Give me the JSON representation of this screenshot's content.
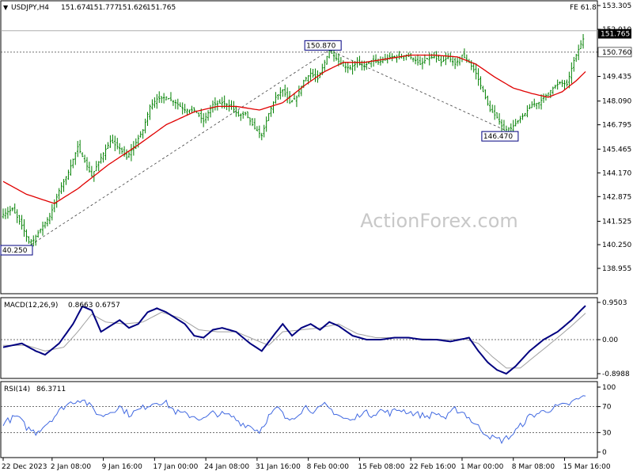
{
  "chart_data": {
    "type": "line",
    "instrument": {
      "header": "USDJPY,H4",
      "ohlc": [
        "151.674",
        "151.777",
        "151.626",
        "151.765"
      ]
    },
    "watermark": "ActionForex.com",
    "fib_label": "FE 61.8",
    "price_axis": {
      "range": [
        138.5,
        153.5
      ],
      "ticks": [
        "153.305",
        "152.010",
        "150.760",
        "149.435",
        "148.090",
        "146.795",
        "145.465",
        "144.170",
        "142.875",
        "141.525",
        "140.250",
        "138.955"
      ],
      "tick_values": [
        153.305,
        152.01,
        150.76,
        149.435,
        148.09,
        146.795,
        145.465,
        144.17,
        142.875,
        141.525,
        140.25,
        138.955
      ]
    },
    "current_price": {
      "label": "151.765",
      "value": 151.765,
      "color": "#000000"
    },
    "horizontal_level": {
      "label": "150.760",
      "value": 150.76
    },
    "fe_level_value": 151.93,
    "annotations": [
      {
        "label": "40.250",
        "bar": 12,
        "value": 140.25
      },
      {
        "label": "150.870",
        "bar": 140,
        "value": 150.87
      },
      {
        "label": "146.470",
        "bar": 216,
        "value": 146.47
      }
    ],
    "trendlines": [
      {
        "from": {
          "bar": 12,
          "value": 140.25
        },
        "to": {
          "bar": 140,
          "value": 150.87
        }
      },
      {
        "from": {
          "bar": 140,
          "value": 150.87
        },
        "to": {
          "bar": 216,
          "value": 146.47
        }
      }
    ],
    "x_labels": [
      "22 Dec 2023",
      "2 Jan 08:00",
      "9 Jan 16:00",
      "17 Jan 00:00",
      "24 Jan 08:00",
      "31 Jan 16:00",
      "8 Feb 00:00",
      "15 Feb 08:00",
      "22 Feb 16:00",
      "1 Mar 00:00",
      "8 Mar 08:00",
      "15 Mar 16:00"
    ],
    "x_label_bars": [
      0,
      21,
      43,
      65,
      87,
      109,
      131,
      153,
      175,
      197,
      219,
      241
    ],
    "bar_count": 250,
    "price_anchors": [
      [
        0,
        141.9
      ],
      [
        4,
        142.2
      ],
      [
        8,
        141.3
      ],
      [
        11,
        140.4
      ],
      [
        13,
        140.5
      ],
      [
        16,
        141.1
      ],
      [
        20,
        141.8
      ],
      [
        24,
        143.2
      ],
      [
        28,
        144.2
      ],
      [
        32,
        145.6
      ],
      [
        35,
        144.8
      ],
      [
        38,
        144.0
      ],
      [
        42,
        145.0
      ],
      [
        46,
        145.9
      ],
      [
        50,
        145.5
      ],
      [
        53,
        145.0
      ],
      [
        56,
        145.6
      ],
      [
        60,
        146.5
      ],
      [
        63,
        147.8
      ],
      [
        66,
        148.2
      ],
      [
        70,
        148.3
      ],
      [
        74,
        148.0
      ],
      [
        78,
        147.6
      ],
      [
        82,
        147.6
      ],
      [
        86,
        147.0
      ],
      [
        90,
        147.9
      ],
      [
        94,
        148.0
      ],
      [
        98,
        147.8
      ],
      [
        101,
        147.3
      ],
      [
        104,
        147.4
      ],
      [
        108,
        146.6
      ],
      [
        111,
        146.2
      ],
      [
        114,
        147.4
      ],
      [
        117,
        148.3
      ],
      [
        120,
        148.7
      ],
      [
        123,
        148.0
      ],
      [
        126,
        148.3
      ],
      [
        129,
        149.2
      ],
      [
        132,
        149.6
      ],
      [
        135,
        149.3
      ],
      [
        138,
        150.2
      ],
      [
        140,
        150.85
      ],
      [
        143,
        150.4
      ],
      [
        146,
        150.0
      ],
      [
        149,
        149.9
      ],
      [
        152,
        150.2
      ],
      [
        155,
        150.0
      ],
      [
        158,
        150.3
      ],
      [
        161,
        150.2
      ],
      [
        164,
        150.4
      ],
      [
        167,
        150.5
      ],
      [
        170,
        150.5
      ],
      [
        173,
        150.6
      ],
      [
        176,
        150.4
      ],
      [
        179,
        150.1
      ],
      [
        182,
        150.4
      ],
      [
        185,
        150.5
      ],
      [
        188,
        150.2
      ],
      [
        191,
        150.5
      ],
      [
        194,
        150.1
      ],
      [
        197,
        150.6
      ],
      [
        200,
        150.2
      ],
      [
        203,
        149.6
      ],
      [
        206,
        148.6
      ],
      [
        209,
        147.6
      ],
      [
        212,
        147.2
      ],
      [
        215,
        146.5
      ],
      [
        218,
        146.6
      ],
      [
        221,
        147.0
      ],
      [
        224,
        147.4
      ],
      [
        227,
        147.9
      ],
      [
        230,
        148.0
      ],
      [
        233,
        148.4
      ],
      [
        236,
        148.8
      ],
      [
        239,
        149.1
      ],
      [
        242,
        149.0
      ],
      [
        245,
        150.3
      ],
      [
        248,
        151.2
      ],
      [
        250,
        151.765
      ]
    ],
    "ma_anchors": [
      [
        0,
        143.7
      ],
      [
        10,
        143.0
      ],
      [
        22,
        142.5
      ],
      [
        32,
        143.3
      ],
      [
        45,
        144.6
      ],
      [
        58,
        145.7
      ],
      [
        70,
        146.8
      ],
      [
        82,
        147.5
      ],
      [
        92,
        147.8
      ],
      [
        100,
        147.8
      ],
      [
        110,
        147.6
      ],
      [
        120,
        148.0
      ],
      [
        130,
        149.0
      ],
      [
        138,
        149.7
      ],
      [
        146,
        150.2
      ],
      [
        155,
        150.2
      ],
      [
        165,
        150.4
      ],
      [
        175,
        150.6
      ],
      [
        185,
        150.6
      ],
      [
        195,
        150.5
      ],
      [
        203,
        150.1
      ],
      [
        211,
        149.4
      ],
      [
        219,
        148.8
      ],
      [
        227,
        148.5
      ],
      [
        234,
        148.3
      ],
      [
        240,
        148.6
      ],
      [
        246,
        149.2
      ],
      [
        250,
        149.7
      ]
    ],
    "macd": {
      "label": "MACD(12,26,9)",
      "values_text": "0.8663 0.6757",
      "ticks": [
        "0.9503",
        "0.00",
        "-0.8988"
      ],
      "tick_values": [
        0.9503,
        0.0,
        -0.8988
      ],
      "range": [
        -1.0,
        1.1
      ],
      "main_anchors": [
        [
          0,
          -0.2
        ],
        [
          8,
          -0.1
        ],
        [
          14,
          -0.3
        ],
        [
          18,
          -0.4
        ],
        [
          24,
          -0.1
        ],
        [
          30,
          0.4
        ],
        [
          34,
          0.85
        ],
        [
          38,
          0.75
        ],
        [
          42,
          0.2
        ],
        [
          46,
          0.35
        ],
        [
          50,
          0.5
        ],
        [
          54,
          0.3
        ],
        [
          58,
          0.4
        ],
        [
          62,
          0.7
        ],
        [
          66,
          0.8
        ],
        [
          70,
          0.7
        ],
        [
          74,
          0.55
        ],
        [
          78,
          0.4
        ],
        [
          82,
          0.1
        ],
        [
          86,
          0.05
        ],
        [
          90,
          0.25
        ],
        [
          94,
          0.3
        ],
        [
          100,
          0.2
        ],
        [
          106,
          -0.1
        ],
        [
          111,
          -0.3
        ],
        [
          116,
          0.1
        ],
        [
          120,
          0.4
        ],
        [
          124,
          0.1
        ],
        [
          128,
          0.3
        ],
        [
          132,
          0.4
        ],
        [
          136,
          0.25
        ],
        [
          140,
          0.45
        ],
        [
          144,
          0.35
        ],
        [
          150,
          0.1
        ],
        [
          156,
          0.0
        ],
        [
          162,
          0.0
        ],
        [
          168,
          0.05
        ],
        [
          174,
          0.05
        ],
        [
          180,
          0.0
        ],
        [
          186,
          0.0
        ],
        [
          192,
          -0.05
        ],
        [
          196,
          0.0
        ],
        [
          200,
          0.05
        ],
        [
          204,
          -0.3
        ],
        [
          208,
          -0.6
        ],
        [
          212,
          -0.8
        ],
        [
          216,
          -0.9
        ],
        [
          220,
          -0.7
        ],
        [
          226,
          -0.3
        ],
        [
          232,
          0.0
        ],
        [
          238,
          0.2
        ],
        [
          244,
          0.5
        ],
        [
          248,
          0.75
        ],
        [
          250,
          0.8663
        ]
      ],
      "signal_anchors": [
        [
          0,
          -0.15
        ],
        [
          10,
          -0.15
        ],
        [
          18,
          -0.3
        ],
        [
          26,
          -0.2
        ],
        [
          32,
          0.2
        ],
        [
          38,
          0.65
        ],
        [
          44,
          0.45
        ],
        [
          52,
          0.4
        ],
        [
          60,
          0.45
        ],
        [
          68,
          0.7
        ],
        [
          76,
          0.55
        ],
        [
          84,
          0.25
        ],
        [
          92,
          0.2
        ],
        [
          100,
          0.2
        ],
        [
          108,
          0.0
        ],
        [
          114,
          -0.15
        ],
        [
          120,
          0.2
        ],
        [
          128,
          0.25
        ],
        [
          136,
          0.3
        ],
        [
          144,
          0.4
        ],
        [
          152,
          0.15
        ],
        [
          160,
          0.05
        ],
        [
          170,
          0.05
        ],
        [
          180,
          0.02
        ],
        [
          190,
          0.0
        ],
        [
          198,
          0.02
        ],
        [
          204,
          -0.1
        ],
        [
          210,
          -0.45
        ],
        [
          216,
          -0.75
        ],
        [
          222,
          -0.75
        ],
        [
          228,
          -0.45
        ],
        [
          236,
          -0.05
        ],
        [
          244,
          0.35
        ],
        [
          250,
          0.6757
        ]
      ]
    },
    "rsi": {
      "label": "RSI(14)",
      "value_text": "86.3711",
      "ticks": [
        "100",
        "70",
        "30",
        "0"
      ],
      "tick_values": [
        100,
        70,
        30,
        0
      ],
      "range": [
        0,
        100
      ],
      "levels": [
        70,
        30
      ],
      "anchors": [
        [
          0,
          45
        ],
        [
          6,
          55
        ],
        [
          10,
          38
        ],
        [
          14,
          30
        ],
        [
          18,
          42
        ],
        [
          22,
          55
        ],
        [
          26,
          70
        ],
        [
          30,
          78
        ],
        [
          34,
          82
        ],
        [
          38,
          68
        ],
        [
          42,
          55
        ],
        [
          46,
          62
        ],
        [
          50,
          70
        ],
        [
          54,
          58
        ],
        [
          58,
          64
        ],
        [
          62,
          72
        ],
        [
          66,
          78
        ],
        [
          70,
          75
        ],
        [
          74,
          62
        ],
        [
          78,
          58
        ],
        [
          82,
          55
        ],
        [
          86,
          50
        ],
        [
          90,
          60
        ],
        [
          94,
          58
        ],
        [
          98,
          55
        ],
        [
          102,
          45
        ],
        [
          106,
          40
        ],
        [
          110,
          32
        ],
        [
          114,
          55
        ],
        [
          118,
          68
        ],
        [
          122,
          48
        ],
        [
          126,
          58
        ],
        [
          130,
          70
        ],
        [
          134,
          62
        ],
        [
          138,
          72
        ],
        [
          142,
          62
        ],
        [
          146,
          52
        ],
        [
          150,
          48
        ],
        [
          154,
          62
        ],
        [
          158,
          58
        ],
        [
          162,
          64
        ],
        [
          166,
          60
        ],
        [
          170,
          66
        ],
        [
          174,
          62
        ],
        [
          178,
          58
        ],
        [
          182,
          55
        ],
        [
          186,
          60
        ],
        [
          190,
          52
        ],
        [
          194,
          66
        ],
        [
          198,
          60
        ],
        [
          202,
          45
        ],
        [
          206,
          32
        ],
        [
          210,
          22
        ],
        [
          214,
          18
        ],
        [
          218,
          25
        ],
        [
          222,
          40
        ],
        [
          226,
          55
        ],
        [
          230,
          60
        ],
        [
          234,
          65
        ],
        [
          238,
          70
        ],
        [
          242,
          72
        ],
        [
          246,
          80
        ],
        [
          250,
          86.37
        ]
      ]
    },
    "colors": {
      "background": "#ffffff",
      "candles": "#008000",
      "moving_average": "#e00000",
      "macd_main": "#000080",
      "macd_signal": "#a0a0a0",
      "rsi_line": "#4169e1",
      "grid_dash": "#404040",
      "watermark": "#c8c8c8"
    }
  }
}
